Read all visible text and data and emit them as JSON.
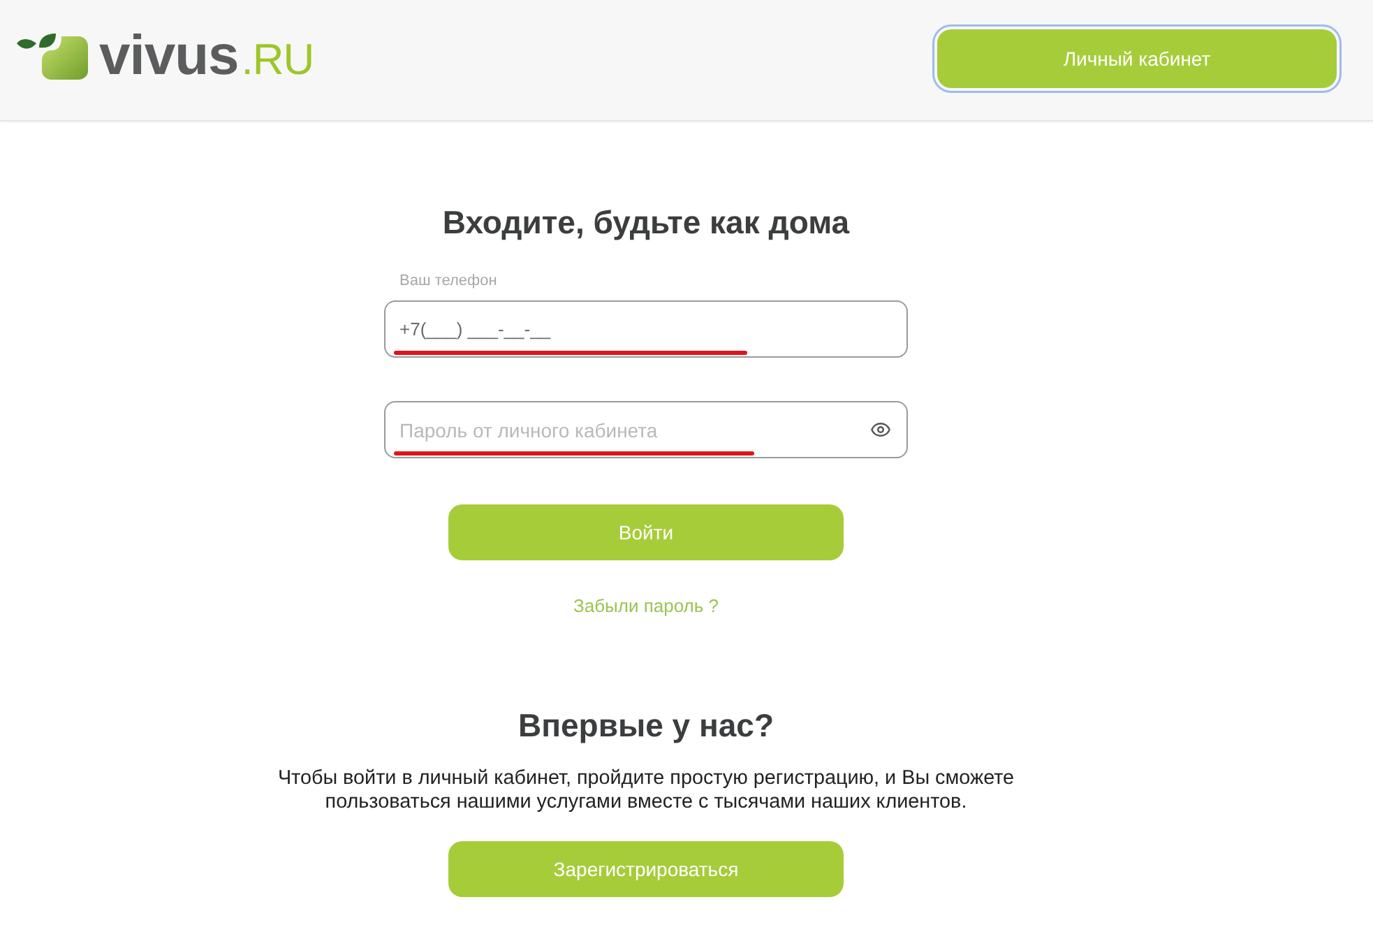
{
  "header": {
    "logo": {
      "name": "vivus",
      "suffix": ".RU"
    },
    "account_button": {
      "label": "Личный кабинет",
      "focused": true
    }
  },
  "login": {
    "title": "Входите, будьте как дома",
    "fields": [
      {
        "kind": "phone",
        "label": "Ваш телефон",
        "value": "+7(___) ___-__-__",
        "marked": true
      },
      {
        "kind": "password",
        "placeholder": "Пароль от личного кабинета",
        "marked": true
      }
    ],
    "submit": "Войти",
    "forgot_link": "Забыли пароль ?"
  },
  "signup": {
    "title": "Впервые у нас?",
    "text": "Чтобы войти в личный кабинет, пройдите простую регистрацию, и Вы сможете\nпользоваться нашими услугами вместе с тысячами наших клиентов.",
    "button": "Зарегистрироваться"
  }
}
